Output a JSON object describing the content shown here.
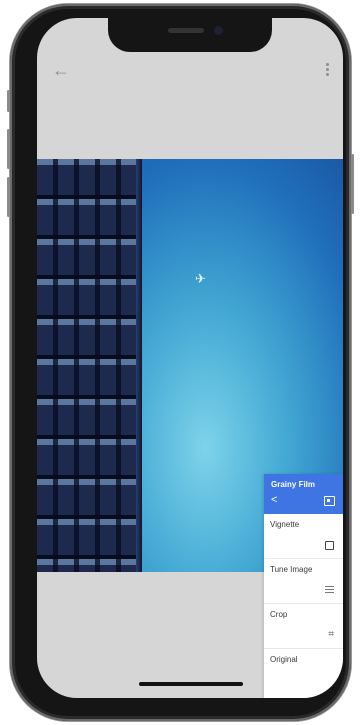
{
  "app": {
    "back_icon": "arrow-left-icon",
    "more_icon": "more-vertical-icon"
  },
  "filter_panel": {
    "title": "Grainy Film",
    "back_glyph": "<",
    "compare_icon": "compare-icon",
    "items": [
      {
        "label": "Vignette",
        "icon": "vignette-icon"
      },
      {
        "label": "Tune Image",
        "icon": "sliders-icon"
      },
      {
        "label": "Crop",
        "icon": "crop-icon"
      },
      {
        "label": "Original",
        "icon": ""
      }
    ]
  },
  "colors": {
    "accent": "#3f74e3",
    "panel_bg": "#ffffff",
    "screen_bg": "#d6d6d6"
  }
}
